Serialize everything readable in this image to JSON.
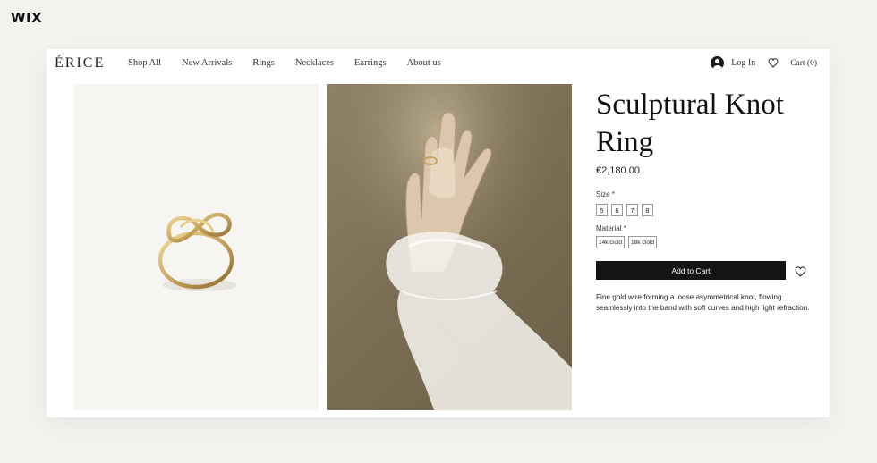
{
  "platform": {
    "logo": "WIX"
  },
  "header": {
    "brand": "ÉRICE",
    "nav": [
      "Shop All",
      "New Arrivals",
      "Rings",
      "Necklaces",
      "Earrings",
      "About us"
    ],
    "login_label": "Log In",
    "cart_label": "Cart (0)"
  },
  "product": {
    "title": "Sculptural Knot Ring",
    "price": "€2,180.00",
    "size_label": "Size *",
    "sizes": [
      "5",
      "6",
      "7",
      "8"
    ],
    "material_label": "Material *",
    "materials": [
      "14k Gold",
      "18k Gold"
    ],
    "add_to_cart": "Add to Cart",
    "description": "Fine gold wire forming a loose asymmetrical knot, flowing seamlessly into the band with soft curves and high light refraction."
  },
  "icons": {
    "user": "user-avatar-icon",
    "wishlist": "heart-icon"
  },
  "colors": {
    "background": "#f2f2ee",
    "button": "#141414",
    "gold": "#c9a45c"
  }
}
